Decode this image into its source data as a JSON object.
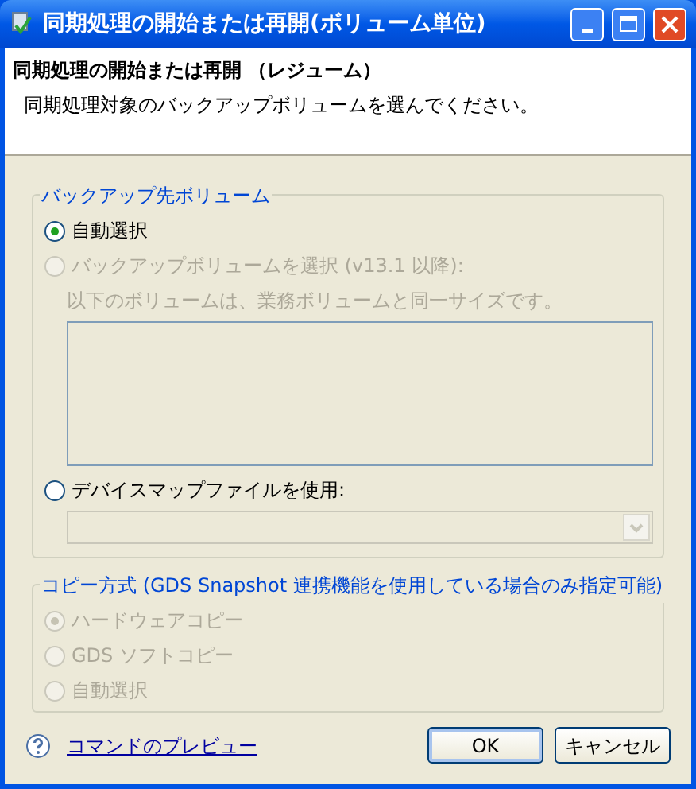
{
  "window": {
    "title": "同期処理の開始または再開(ボリューム単位)"
  },
  "header": {
    "title": "同期処理の開始または再開 （レジューム）",
    "description": "同期処理対象のバックアップボリュームを選んでください。"
  },
  "groups": [
    {
      "title": "バックアップ先ボリューム",
      "items": [
        {
          "kind": "radio",
          "label": "自動選択",
          "selected": true,
          "disabled": false
        },
        {
          "kind": "radio",
          "label": "バックアップボリュームを選択 (v13.1 以降):",
          "selected": false,
          "disabled": true
        },
        {
          "kind": "note",
          "text": "以下のボリュームは、業務ボリュームと同一サイズです。",
          "disabled": true
        },
        {
          "kind": "listbox",
          "disabled": true
        },
        {
          "kind": "radio",
          "label": "デバイスマップファイルを使用:",
          "selected": false,
          "disabled": false
        },
        {
          "kind": "combo",
          "disabled": true
        }
      ]
    },
    {
      "title": "コピー方式 (GDS Snapshot 連携機能を使用している場合のみ指定可能)",
      "items": [
        {
          "kind": "radio",
          "label": "ハードウェアコピー",
          "selected": true,
          "disabled": true
        },
        {
          "kind": "radio",
          "label": "GDS ソフトコピー",
          "selected": false,
          "disabled": true
        },
        {
          "kind": "radio",
          "label": "自動選択",
          "selected": false,
          "disabled": true
        }
      ]
    }
  ],
  "footer": {
    "link": "コマンドのプレビュー",
    "buttons": [
      {
        "label": "OK",
        "default": true
      },
      {
        "label": "キャンセル",
        "default": false
      }
    ]
  }
}
